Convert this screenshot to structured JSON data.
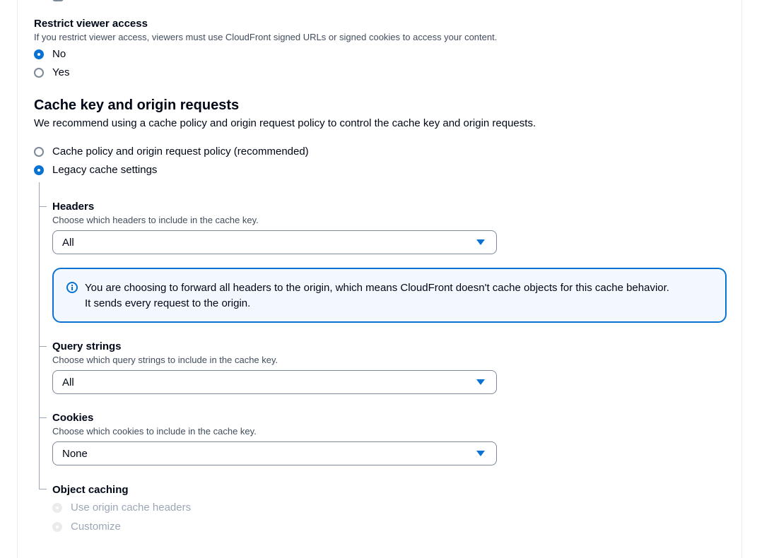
{
  "restrict_viewer_access": {
    "label": "Restrict viewer access",
    "description": "If you restrict viewer access, viewers must use CloudFront signed URLs or signed cookies to access your content.",
    "options": [
      "No",
      "Yes"
    ],
    "selected": "No"
  },
  "cache_key": {
    "heading": "Cache key and origin requests",
    "description": "We recommend using a cache policy and origin request policy to control the cache key and origin requests.",
    "options": [
      "Cache policy and origin request policy (recommended)",
      "Legacy cache settings"
    ],
    "selected": "Legacy cache settings"
  },
  "headers": {
    "label": "Headers",
    "description": "Choose which headers to include in the cache key.",
    "value": "All"
  },
  "alert": {
    "line1": "You are choosing to forward all headers to the origin, which means CloudFront doesn't cache objects for this cache behavior.",
    "line2": "It sends every request to the origin."
  },
  "query_strings": {
    "label": "Query strings",
    "description": "Choose which query strings to include in the cache key.",
    "value": "All"
  },
  "cookies": {
    "label": "Cookies",
    "description": "Choose which cookies to include in the cache key.",
    "value": "None"
  },
  "object_caching": {
    "label": "Object caching",
    "options": [
      "Use origin cache headers",
      "Customize"
    ]
  },
  "colors": {
    "accent": "#0972d3",
    "alert_bg": "#f2f8fd",
    "text": "#000716",
    "secondary_text": "#414d5c",
    "disabled": "#9ba7b6"
  },
  "icons": {
    "alert": "info-icon",
    "select": "caret-down-icon"
  }
}
